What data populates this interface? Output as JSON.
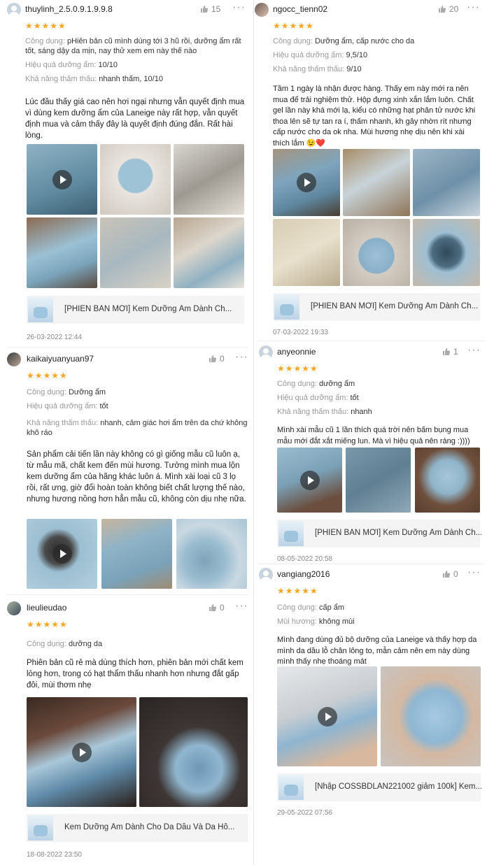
{
  "reviews": {
    "r1": {
      "username": "thuylinh_2.5.0.9.1.9.9.8",
      "likes": "15",
      "stars": "★★★★★",
      "attr1_key": "Công dụng:",
      "attr1_val": " pHiên bản cũ mình dùng tới 3 hũ rồi, dưỡng ẩm rất tốt, sáng dậy da mịn, nay thử xem em này thế nào",
      "attr2_key": "Hiệu quả dưỡng ẩm:",
      "attr2_val": " 10/10",
      "attr3_key": "Khả năng thấm thấu:",
      "attr3_val": " nhanh thấm, 10/10",
      "text": "Lúc đầu thấy giá cao nên hơi ngại nhưng vẫn quyết định mua vì dùng kem dưỡng ẩm của Laneige này rất hợp, vẫn quyết định mua và cảm thấy đây là quyết định đúng đắn. Rất hài lòng.",
      "product": "[PHIÊN BẢN MỚI] Kem Dưỡng Ẩm Dành Ch...",
      "date": "26-03-2022 12:44"
    },
    "r2": {
      "username": "ngocc_tienn02",
      "likes": "20",
      "stars": "★★★★★",
      "attr1_key": "Công dụng:",
      "attr1_val": " Dưỡng ẩm, cấp nước cho da",
      "attr2_key": "Hiệu quả dưỡng ẩm:",
      "attr2_val": " 9,5/10",
      "attr3_key": "Khả năng thấm thấu:",
      "attr3_val": " 9/10",
      "text": "Tầm 1 ngày là nhận được hàng. Thấy em này mới ra nên mua để trải nghiệm thử. Hộp đựng xinh xắn lắm luôn. Chất gel lần này khá mới lạ, kiểu có những hạt phân tử nước khi thoa lên sẽ tự tan ra í, thấm nhanh, kh gây nhờn rít nhưng cấp nước cho da ok nha. Mùi hương nhẹ dịu nên khi xài thích lắm 😉❤️",
      "product": "[PHIÊN BẢN MỚI] Kem Dưỡng Ẩm Dành Ch...",
      "date": "07-03-2022 19:33"
    },
    "r3": {
      "username": "kaikaiyuanyuan97",
      "likes": "0",
      "stars": "★★★★★",
      "attr1_key": "Công dụng:",
      "attr1_val": " Dưỡng ẩm",
      "attr2_key": "Hiệu quả dưỡng ẩm:",
      "attr2_val": " tốt",
      "attr3_key": "Khả năng thấm thấu:",
      "attr3_val": " nhanh, cảm giác hơi ẩm trên da chứ không khô ráo",
      "text": "Sản phẩm cải tiến lần này không có gì giống mẫu cũ luôn ạ, từ mẫu mã, chất kem đến mùi hương. Tưởng mình mua lộn kem dưỡng ẩm của hãng khác luôn á. Mình xài loại cũ 3 lọ rồi, rất ưng, giờ đổi hoàn toàn không biết chất lượng thế nào, nhưng hương nồng hơn hẳn mẫu cũ, không còn dịu nhẹ nữa."
    },
    "r4": {
      "username": "anyeonnie",
      "likes": "1",
      "stars": "★★★★★",
      "attr1_key": "Công dụng:",
      "attr1_val": " dưỡng ẩm",
      "attr2_key": "Hiệu quả dưỡng ẩm:",
      "attr2_val": " tốt",
      "attr3_key": "Khả năng thấm thấu:",
      "attr3_val": " nhanh",
      "text": "Mình xài mẫu cũ 1 lần thích quá trời nên bấm bụng mua mẫu mới đắt xắt miếng lun. Mà vì hiệu quả nên ráng :))))",
      "product": "[PHIÊN BẢN MỚI] Kem Dưỡng Ẩm Dành Ch...",
      "date": "08-05-2022 20:58"
    },
    "r5": {
      "username": "lieulieudao",
      "likes": "0",
      "stars": "★★★★★",
      "attr1_key": "Công dụng:",
      "attr1_val": " dưỡng da",
      "text": "Phiên bản cũ rẻ mà dùng thích hơn, phiên bản mới chất kem lỏng hơn, trong có hạt thẩm thấu nhanh hơn nhưng đắt gấp đôi, mùi thơm nhẹ",
      "product": "Kem Dưỡng Ẩm Dành Cho Da Dầu Và Da Hỗ...",
      "date": "18-08-2022 23:50"
    },
    "r6": {
      "username": "vangiang2016",
      "likes": "0",
      "stars": "★★★★★",
      "attr1_key": "Công dụng:",
      "attr1_val": " cấp ẩm",
      "attr2_key": "Mùi hương:",
      "attr2_val": " không mùi",
      "text": "Mình đang dùng đủ bộ dưỡng của Laneige và thấy hợp da mình da dầu lỗ chân lông to, mẫn cảm nên em này dùng mình thấy nhẹ thoáng mát",
      "product": "[Nhập COSSBDLAN221002 giảm 100k] Kem...",
      "date": "29-05-2022 07:56"
    }
  },
  "colors": {
    "star": "#f5a623",
    "muted": "#999999",
    "product_bg": "#f4f4f4"
  },
  "icons": {
    "like": "thumb-up-icon",
    "more": "more-dots-icon",
    "play": "play-icon",
    "avatar": "default-avatar-icon"
  }
}
